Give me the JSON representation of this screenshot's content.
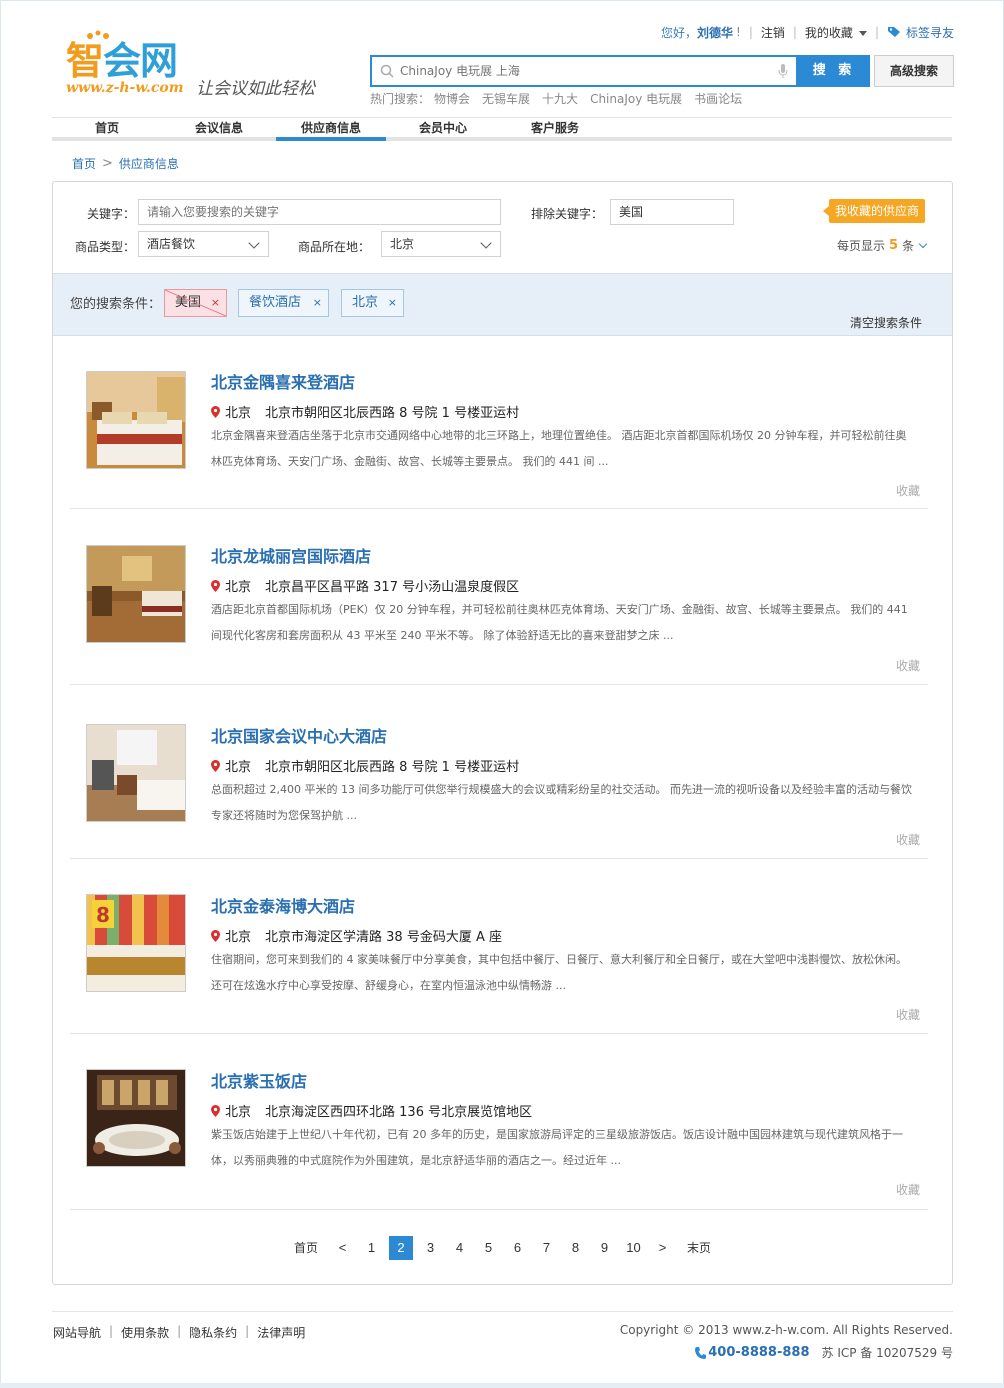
{
  "brand": {
    "name_a": "智",
    "name_b": "会网",
    "url": "www.z-h-w.com",
    "slogan": "让会议如此轻松"
  },
  "user_bar": {
    "greeting": "您好，",
    "username": "刘德华",
    "exclaim": "!",
    "logout": "注销",
    "favorites": "我的收藏",
    "tag_search": "标签寻友"
  },
  "search": {
    "placeholder": "ChinaJoy 电玩展 上海",
    "button": "搜 索",
    "advanced": "高级搜索",
    "hot_label": "热门搜索：",
    "hot_terms": [
      "物博会",
      "无锡车展",
      "十九大",
      "ChinaJoy 电玩展",
      "书画论坛"
    ]
  },
  "nav": {
    "items": [
      "首页",
      "会议信息",
      "供应商信息",
      "会员中心",
      "客户服务"
    ],
    "active_index": 2
  },
  "breadcrumb": {
    "home": "首页",
    "current": "供应商信息"
  },
  "filters": {
    "keyword_label": "关键字：",
    "keyword_placeholder": "请输入您要搜索的关键字",
    "exclude_label": "排除关键字：",
    "exclude_value": "美国",
    "category_label": "商品类型：",
    "category_value": "酒店餐饮",
    "location_label": "商品所在地：",
    "location_value": "北京",
    "fav_suppliers": "我收藏的供应商",
    "per_page_label": "每页显示",
    "per_page_value": "5",
    "per_page_unit": "条"
  },
  "conditions": {
    "label": "您的搜索条件：",
    "chips": [
      "美国",
      "餐饮酒店",
      "北京"
    ],
    "close_glyph": "×",
    "clear": "清空搜索条件"
  },
  "results": [
    {
      "title": "北京金隅喜来登酒店",
      "city": "北京",
      "address": "北京市朝阳区北辰西路 8 号院 1 号楼亚运村",
      "desc": "北京金隅喜来登酒店坐落于北京市交通网络中心地带的北三环路上，地理位置绝佳。 酒店距北京首都国际机场仅 20 分钟车程，并可轻松前往奥林匹克体育场、天安门广场、金融街、故宫、长城等主要景点。 我们的 441 间 ...",
      "fav": "收藏",
      "image": "hotel-room-warm"
    },
    {
      "title": "北京龙城丽宫国际酒店",
      "city": "北京",
      "address": "北京昌平区昌平路 317 号小汤山温泉度假区",
      "desc": "酒店距北京首都国际机场（PEK）仅 20 分钟车程，并可轻松前往奥林匹克体育场、天安门广场、金融街、故宫、长城等主要景点。 我们的 441 间现代化客房和套房面积从 43 平米至 240 平米不等。 除了体验舒适无比的喜来登甜梦之床 ...",
      "fav": "收藏",
      "image": "hotel-room-wood"
    },
    {
      "title": "北京国家会议中心大酒店",
      "city": "北京",
      "address": "北京市朝阳区北辰西路 8 号院 1 号楼亚运村",
      "desc": "总面积超过 2,400 平米的 13 间多功能厅可供您举行规模盛大的会议或精彩纷呈的社交活动。 而先进一流的视听设备以及经验丰富的活动与餐饮专家还将随时为您保驾护航 ...",
      "fav": "收藏",
      "image": "hotel-room-bright"
    },
    {
      "title": "北京金泰海博大酒店",
      "city": "北京",
      "address": "北京市海淀区学清路 38 号金码大厦 A 座",
      "desc": "住宿期间，您可来到我们的 4 家美味餐厅中分享美食，其中包括中餐厅、日餐厅、意大利餐厅和全日餐厅，或在大堂吧中浅斟慢饮、放松休闲。 还可在炫逸水疗中心享受按摩、舒缓身心，在室内恒温泳池中纵情畅游 ...",
      "fav": "收藏",
      "image": "hotel-room-super8"
    },
    {
      "title": "北京紫玉饭店",
      "city": "北京",
      "address": "北京海淀区西四环北路 136 号北京展览馆地区",
      "desc": "紫玉饭店始建于上世纪八十年代初，已有 20 多年的历史，是国家旅游局评定的三星级旅游饭店。饭店设计融中国园林建筑与现代建筑风格于一体，以秀丽典雅的中式庭院作为外围建筑，是北京舒适华丽的酒店之一。经过近年 ...",
      "fav": "收藏",
      "image": "banquet-hall"
    }
  ],
  "pagination": {
    "first": "首页",
    "prev": "<",
    "pages": [
      "1",
      "2",
      "3",
      "4",
      "5",
      "6",
      "7",
      "8",
      "9",
      "10"
    ],
    "current": "2",
    "next": ">",
    "last": "末页"
  },
  "footer": {
    "links": [
      "网站导航",
      "使用条款",
      "隐私条约",
      "法律声明"
    ],
    "copyright": "Copyright © 2013 www.z-h-w.com. All Rights Reserved.",
    "phone": "400-8888-888",
    "icp": "苏 ICP 备 10207529 号"
  },
  "colors": {
    "primary": "#2b8ad3",
    "link": "#2a6fb0",
    "accent": "#f29b1d",
    "badge": "#f5a623",
    "pin": "#d9302b"
  }
}
